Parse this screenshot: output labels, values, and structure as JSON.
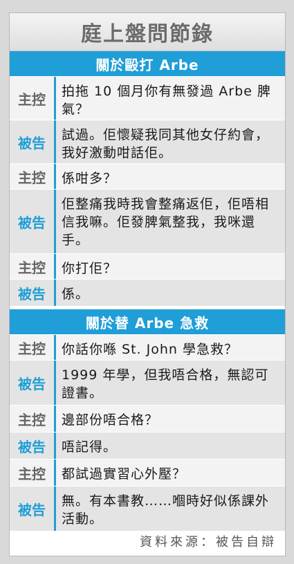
{
  "title": "庭上盤問節錄",
  "sections": [
    {
      "heading": "關於毆打 Arbe"
    },
    {
      "heading": "關於替 Arbe 急救"
    }
  ],
  "rows": [
    {
      "speaker": "主控",
      "text": "拍拖 10 個月你有無發過 Arbe 脾氣？"
    },
    {
      "speaker": "被告",
      "text": "試過。佢懷疑我同其他女仔約會，我好激動咁話佢。"
    },
    {
      "speaker": "主控",
      "text": "係咁多？"
    },
    {
      "speaker": "被告",
      "text": "佢整痛我時我會整痛返佢，佢唔相信我嘛。佢發脾氣整我，我咪還手。"
    },
    {
      "speaker": "主控",
      "text": "你打佢？"
    },
    {
      "speaker": "被告",
      "text": "係。"
    },
    {
      "speaker": "主控",
      "text": "你話你喺 St. John 學急救？"
    },
    {
      "speaker": "被告",
      "text": "1999 年學，但我唔合格，無認可證書。"
    },
    {
      "speaker": "主控",
      "text": "邊部份唔合格？"
    },
    {
      "speaker": "被告",
      "text": "唔記得。"
    },
    {
      "speaker": "主控",
      "text": "都試過實習心外壓？"
    },
    {
      "speaker": "被告",
      "text": "無。有本書教……嗰時好似係課外活動。"
    }
  ],
  "source": "資料來源：被告自辯",
  "colors": {
    "accent": "#1f9ed7",
    "prosecution": "#666666",
    "defendant": "#1f9ed7"
  }
}
